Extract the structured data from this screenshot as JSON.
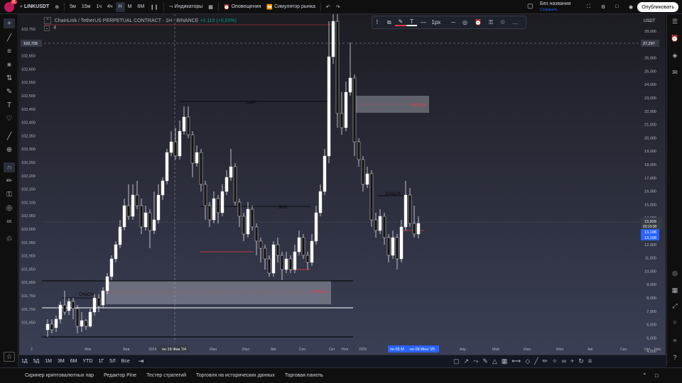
{
  "topbar": {
    "avatar_badge": "11",
    "symbol": "LINKUSDT",
    "timeframes": [
      "5м",
      "15м",
      "1ч",
      "4ч",
      "Н",
      "М",
      "6М"
    ],
    "active_timeframe_index": 4,
    "indicators": "Индикаторы",
    "alerts": "Оповещения",
    "replay": "Симулятор рынка",
    "layout_name": "Без названия",
    "layout_status": "Сохранить",
    "publish": "Опубликовать"
  },
  "legend": {
    "title": "ChainLink / TetherUS PERPETUAL CONTRACT · 1Н · BINANCE",
    "change": "+0,115 (+0,83%)",
    "sub": "4"
  },
  "floating_toolbar": {
    "width_label": "1px"
  },
  "left_axis": {
    "ticks": [
      "102,750",
      "102,700",
      "102,650",
      "102,600",
      "102,550",
      "102,500",
      "102,450",
      "102,400",
      "102,350",
      "102,300",
      "102,250",
      "102,200",
      "102,150",
      "102,100",
      "102,050",
      "102,000",
      "101,950",
      "101,900",
      "101,850",
      "101,800",
      "101,750",
      "101,700",
      "101,650"
    ],
    "crosshair_label": "102,705"
  },
  "right_axis": {
    "currency": "USDT",
    "ticks": [
      "28,000",
      "27,000",
      "26,000",
      "25,000",
      "24,000",
      "23,000",
      "22,000",
      "21,000",
      "20,000",
      "19,000",
      "18,000",
      "17,000",
      "16,000",
      "15,000",
      "14,000",
      "13,000",
      "12,000",
      "11,000",
      "10,000",
      "9,000",
      "8,000",
      "7,000",
      "6,000",
      "5,000",
      "4,000"
    ],
    "crosshair_label": "27,297",
    "price_label": "13,929",
    "countdown": "03:23:30",
    "blue_label_1": "13,198",
    "blue_label_2": "13,198"
  },
  "time_axis": {
    "labels": [
      "2",
      "Янв",
      "Фев",
      "2024",
      "Май",
      "Июн",
      "Июл",
      "Авг",
      "Сен",
      "Окт",
      "Ноя",
      "2025",
      "Фев",
      "Мар",
      "Апр",
      "Май",
      "Июн",
      "Июл",
      "Авг",
      "Сен",
      "Окт",
      "Ноя"
    ],
    "crosshair_date": "пн 19 Фев '24",
    "range_date_1": "пн 05 М",
    "range_date_2": "пн 09 Июн '25"
  },
  "annotations": {
    "conf": "conf",
    "fvg_top": "FVG 1н",
    "shift": "Shift",
    "choch_right": "CHoCH",
    "choch_left": "CHoCH",
    "fvg_bottom": "FVG 1н"
  },
  "bottombar": {
    "timeframes": [
      "1Д",
      "5Д",
      "1М",
      "3М",
      "6М",
      "YTD",
      "1Г",
      "5Л",
      "Все"
    ]
  },
  "panel_tabs": [
    "Скринер криптовалютных пар",
    "Редактор Pine",
    "Тестер стратегий",
    "Торговля на исторических данных",
    "Торговая панель"
  ],
  "colors": {
    "up": "#ffffff",
    "down": "#131313",
    "fvg": "#d1d4dc",
    "accent_red": "#f23645",
    "accent_blue": "#2962ff"
  }
}
